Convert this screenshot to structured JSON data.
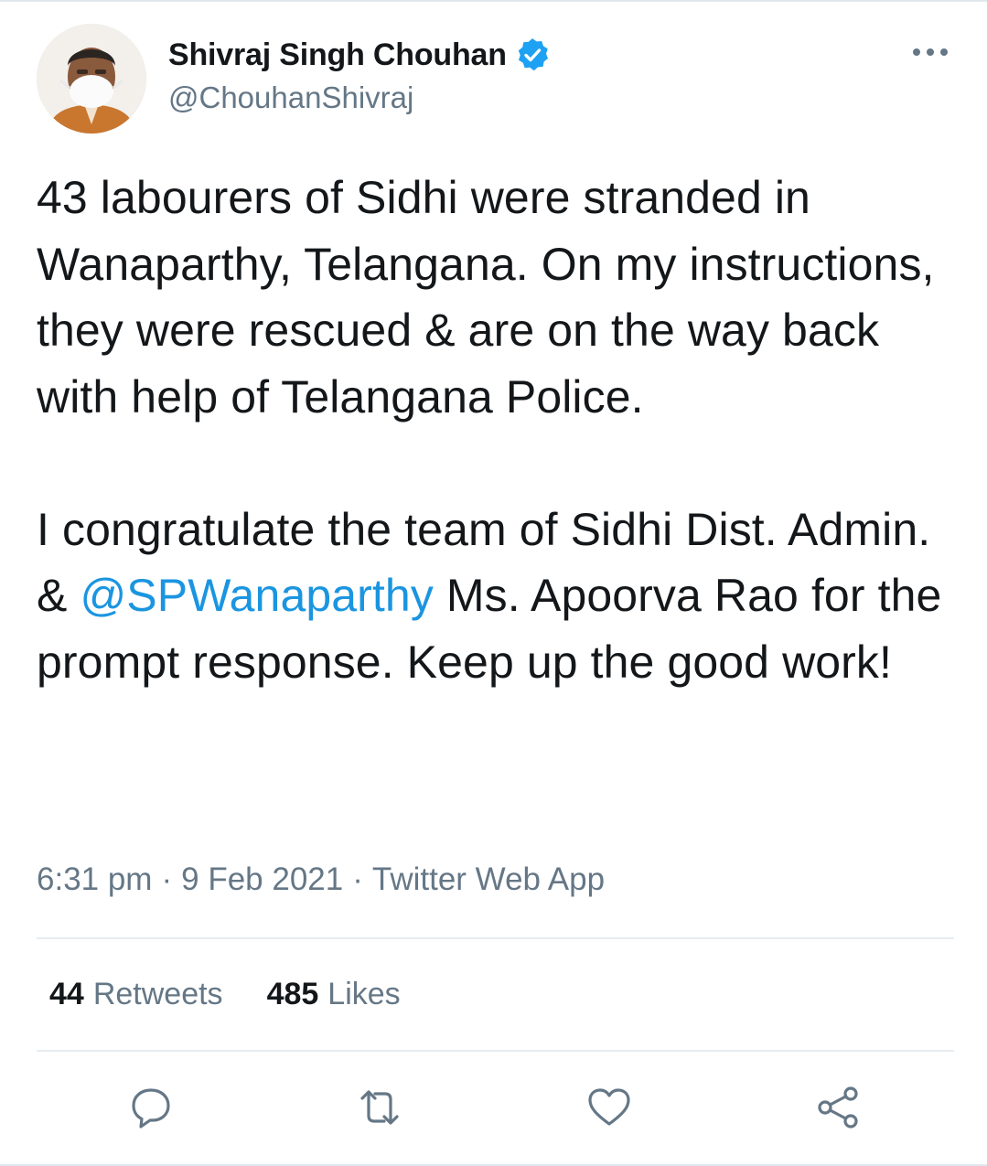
{
  "author": {
    "display_name": "Shivraj Singh Chouhan",
    "handle": "@ChouhanShivraj",
    "verified_icon": "verified-badge-icon"
  },
  "tweet": {
    "paragraph1": "43 labourers of Sidhi were stranded in Wanaparthy, Telangana. On my instructions, they were rescued & are on the way back with help of Telangana Police.",
    "paragraph2_before": "I congratulate the team of Sidhi Dist. Admin. & ",
    "mention": "@SPWanaparthy",
    "paragraph2_after": " Ms. Apoorva Rao for the prompt response. Keep up the good work!"
  },
  "meta": {
    "time": "6:31 pm",
    "separator": "·",
    "date": "9 Feb 2021",
    "source": "Twitter Web App"
  },
  "stats": {
    "retweets_count": "44",
    "retweets_label": "Retweets",
    "likes_count": "485",
    "likes_label": "Likes"
  },
  "actions": [
    "reply-icon",
    "retweet-icon",
    "like-icon",
    "share-icon"
  ],
  "colors": {
    "text": "#14171a",
    "secondary": "#657786",
    "link": "#1b95e0",
    "verified": "#1da1f2",
    "divider": "#e6ecf0"
  }
}
